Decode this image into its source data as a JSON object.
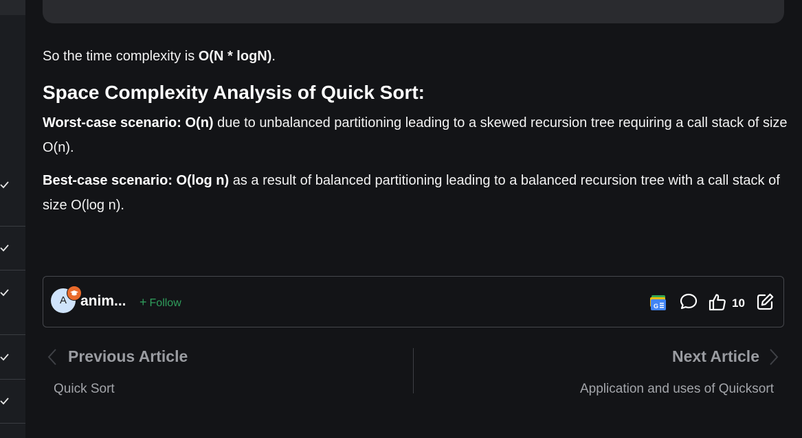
{
  "article": {
    "complexity_prefix": "So the time complexity is ",
    "complexity_value": "O(N * logN)",
    "complexity_suffix": ".",
    "space_heading": "Space Complexity Analysis of Quick Sort:",
    "worst_label": "Worst-case scenario: O(n)",
    "worst_text": " due to unbalanced partitioning leading to a skewed recursion tree requiring a call stack of size O(n).",
    "best_label": "Best-case scenario: O(log n)",
    "best_text": " as a result of balanced partitioning leading to a balanced recursion tree with a call stack of size O(log n)."
  },
  "author": {
    "avatar_letter": "A",
    "name": "anim...",
    "follow_plus": "+",
    "follow_label": "Follow"
  },
  "actions": {
    "like_count": "10",
    "icons": [
      "google-news-icon",
      "comment-icon",
      "thumbs-up-icon",
      "edit-icon"
    ]
  },
  "navigation": {
    "prev_label": "Previous Article",
    "prev_title": "Quick Sort",
    "next_label": "Next Article",
    "next_title": "Application and uses of Quicksort"
  },
  "colors": {
    "background": "#131417",
    "follow_green": "#2f9e5c",
    "badge_orange": "#e96a2b",
    "avatar_bg": "#cfe3fb"
  }
}
